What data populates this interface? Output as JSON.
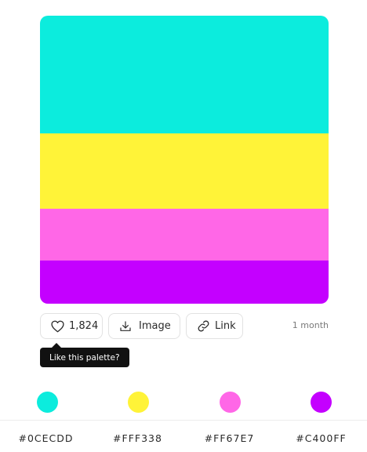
{
  "palette": {
    "colors": [
      {
        "hex": "#0CECDD",
        "label": "#0CECDD"
      },
      {
        "hex": "#FFF338",
        "label": "#FFF338"
      },
      {
        "hex": "#FF67E7",
        "label": "#FF67E7"
      },
      {
        "hex": "#C400FF",
        "label": "#C400FF"
      }
    ]
  },
  "actions": {
    "like_count": "1,824",
    "like_icon": "heart-icon",
    "image_label": "Image",
    "image_icon": "download-icon",
    "link_label": "Link",
    "link_icon": "link-icon"
  },
  "meta": {
    "time_ago": "1 month"
  },
  "tooltip": {
    "text": "Like this palette?"
  }
}
